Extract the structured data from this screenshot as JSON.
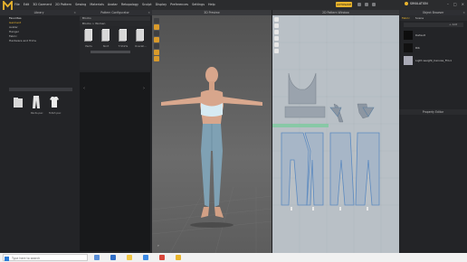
{
  "app": {
    "menu": [
      "File",
      "Edit",
      "3D Garment",
      "2D Pattern",
      "Sewing",
      "Materials",
      "Avatar",
      "Retopology",
      "Sculpt",
      "Display",
      "Preferences",
      "Settings",
      "Help"
    ],
    "save_label": "AUTOSAVE",
    "simulation_label": "SIMULATION",
    "accent": "#e9b42c"
  },
  "library": {
    "title": "Library",
    "items": [
      {
        "label": "Favorites",
        "kind": "head"
      },
      {
        "label": "Garment",
        "kind": "active"
      },
      {
        "label": "Avatar",
        "kind": "normal"
      },
      {
        "label": "Hanger",
        "kind": "normal"
      },
      {
        "label": "Fabric",
        "kind": "normal"
      },
      {
        "label": "Hardware and Trims",
        "kind": "normal"
      }
    ],
    "thumbs": [
      "",
      "Pants.pac",
      "Tshirt.pac"
    ]
  },
  "pattern_panel": {
    "title": "Pattern Configurator",
    "tab": "Blocks",
    "breadcrumb": "Blocks > Women",
    "items": [
      "Pants",
      "Skirt",
      "T-Shirts",
      "Overall..."
    ]
  },
  "viewport3d": {
    "title": "3D Preview",
    "axis_label": "Y",
    "icon_names": [
      "select-icon",
      "transform-icon",
      "sun-icon",
      "folder-icon",
      "move-icon",
      "pin-icon",
      "star-icon"
    ]
  },
  "viewport2d": {
    "title": "2D Pattern Window",
    "icon_names": [
      "cursor-icon",
      "pen-icon",
      "rect-icon",
      "cut-icon",
      "sew-icon",
      "brush-icon"
    ]
  },
  "object_browser": {
    "title": "Object Browser",
    "tabs": [
      "Fabric",
      "Scene"
    ],
    "add_label": "+ Add",
    "fabrics": [
      {
        "name": "Default",
        "color": "#0d0d0d"
      },
      {
        "name": "Rib",
        "color": "#111111"
      },
      {
        "name": "Light-weight_Canvas_FCL1",
        "color": "#a9aab6"
      }
    ]
  },
  "property_editor": {
    "title": "Property Editor"
  },
  "status_bar": {
    "search_placeholder": "Type here to search",
    "time": "",
    "date": ""
  }
}
